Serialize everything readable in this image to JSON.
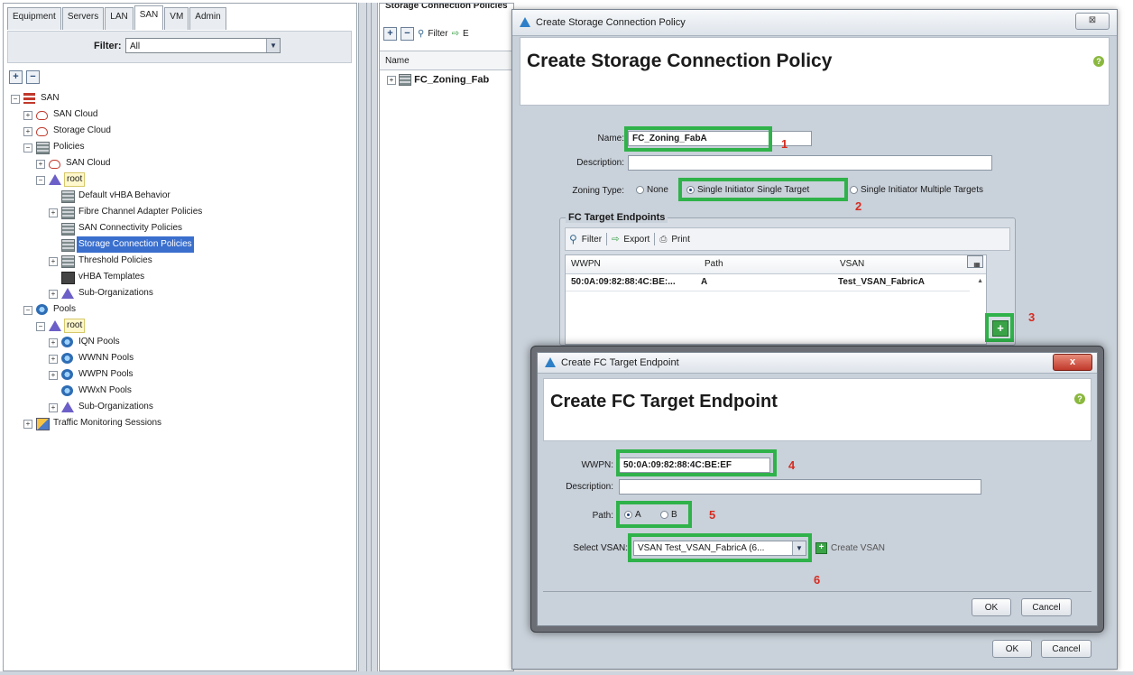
{
  "nav": {
    "tabs": [
      "Equipment",
      "Servers",
      "LAN",
      "SAN",
      "VM",
      "Admin"
    ],
    "active_tab": "SAN",
    "filter_label": "Filter:",
    "filter_value": "All",
    "tree": [
      {
        "label": "SAN",
        "icon": "san-icon",
        "indent": 0,
        "expander": "-"
      },
      {
        "label": "SAN Cloud",
        "icon": "cloud-icon",
        "indent": 1,
        "expander": "+"
      },
      {
        "label": "Storage Cloud",
        "icon": "cloud-icon",
        "indent": 1,
        "expander": "+"
      },
      {
        "label": "Policies",
        "icon": "policy-icon",
        "indent": 1,
        "expander": "-"
      },
      {
        "label": "SAN Cloud",
        "icon": "cloud-icon",
        "indent": 2,
        "expander": "+"
      },
      {
        "label": "root",
        "icon": "org-icon",
        "indent": 2,
        "expander": "-",
        "highlight": "root"
      },
      {
        "label": "Default vHBA Behavior",
        "icon": "policy-icon",
        "indent": 3,
        "expander": ""
      },
      {
        "label": "Fibre Channel Adapter Policies",
        "icon": "policy-icon",
        "indent": 3,
        "expander": "+"
      },
      {
        "label": "SAN Connectivity Policies",
        "icon": "policy-icon",
        "indent": 3,
        "expander": ""
      },
      {
        "label": "Storage Connection Policies",
        "icon": "policy-icon",
        "indent": 3,
        "expander": "",
        "highlight": "selected"
      },
      {
        "label": "Threshold Policies",
        "icon": "policy-icon",
        "indent": 3,
        "expander": "+"
      },
      {
        "label": "vHBA Templates",
        "icon": "template-icon",
        "indent": 3,
        "expander": ""
      },
      {
        "label": "Sub-Organizations",
        "icon": "org-icon",
        "indent": 3,
        "expander": "+"
      },
      {
        "label": "Pools",
        "icon": "pool-icon",
        "indent": 1,
        "expander": "-"
      },
      {
        "label": "root",
        "icon": "org-icon",
        "indent": 2,
        "expander": "-",
        "highlight": "root"
      },
      {
        "label": "IQN Pools",
        "icon": "pool-icon",
        "indent": 3,
        "expander": "+"
      },
      {
        "label": "WWNN Pools",
        "icon": "pool-icon",
        "indent": 3,
        "expander": "+"
      },
      {
        "label": "WWPN Pools",
        "icon": "pool-icon",
        "indent": 3,
        "expander": "+"
      },
      {
        "label": "WWxN Pools",
        "icon": "pool-icon",
        "indent": 3,
        "expander": ""
      },
      {
        "label": "Sub-Organizations",
        "icon": "org-icon",
        "indent": 3,
        "expander": "+"
      },
      {
        "label": "Traffic Monitoring Sessions",
        "icon": "traffic-icon",
        "indent": 1,
        "expander": "+"
      }
    ]
  },
  "middle": {
    "title": "Storage Connection Policies",
    "filter_label": "Filter",
    "export_label": "E",
    "column_name": "Name",
    "row_label": "FC_Zoning_Fab"
  },
  "dialog1": {
    "window_title": "Create Storage Connection Policy",
    "heading": "Create Storage Connection Policy",
    "name_label": "Name:",
    "name_value": "FC_Zoning_FabA",
    "description_label": "Description:",
    "description_value": "",
    "zoning_label": "Zoning Type:",
    "zoning_options": [
      "None",
      "Single Initiator Single Target",
      "Single Initiator Multiple Targets"
    ],
    "zoning_selected": 1,
    "endpoints_legend": "FC Target Endpoints",
    "grid_toolbar": {
      "filter": "Filter",
      "export": "Export",
      "print": "Print"
    },
    "columns": [
      "WWPN",
      "Path",
      "VSAN"
    ],
    "rows": [
      {
        "wwpn": "50:0A:09:82:88:4C:BE:...",
        "path": "A",
        "vsan": "Test_VSAN_FabricA"
      }
    ],
    "ok_label": "OK",
    "cancel_label": "Cancel",
    "close_label": "⊠"
  },
  "dialog2": {
    "window_title": "Create FC Target Endpoint",
    "heading": "Create FC Target Endpoint",
    "wwpn_label": "WWPN:",
    "wwpn_value": "50:0A:09:82:88:4C:BE:EF",
    "description_label": "Description:",
    "description_value": "",
    "path_label": "Path:",
    "path_options": [
      "A",
      "B"
    ],
    "path_selected": 0,
    "vsan_label": "Select VSAN:",
    "vsan_value": "VSAN Test_VSAN_FabricA (6...",
    "create_vsan_label": "Create VSAN",
    "ok_label": "OK",
    "cancel_label": "Cancel",
    "close_label": "x"
  },
  "annotations": {
    "step1": "1",
    "step2": "2",
    "step3": "3",
    "step4": "4",
    "step5": "5",
    "step6": "6",
    "highlight_color": "#2fb24a",
    "number_color": "#d62b20"
  }
}
